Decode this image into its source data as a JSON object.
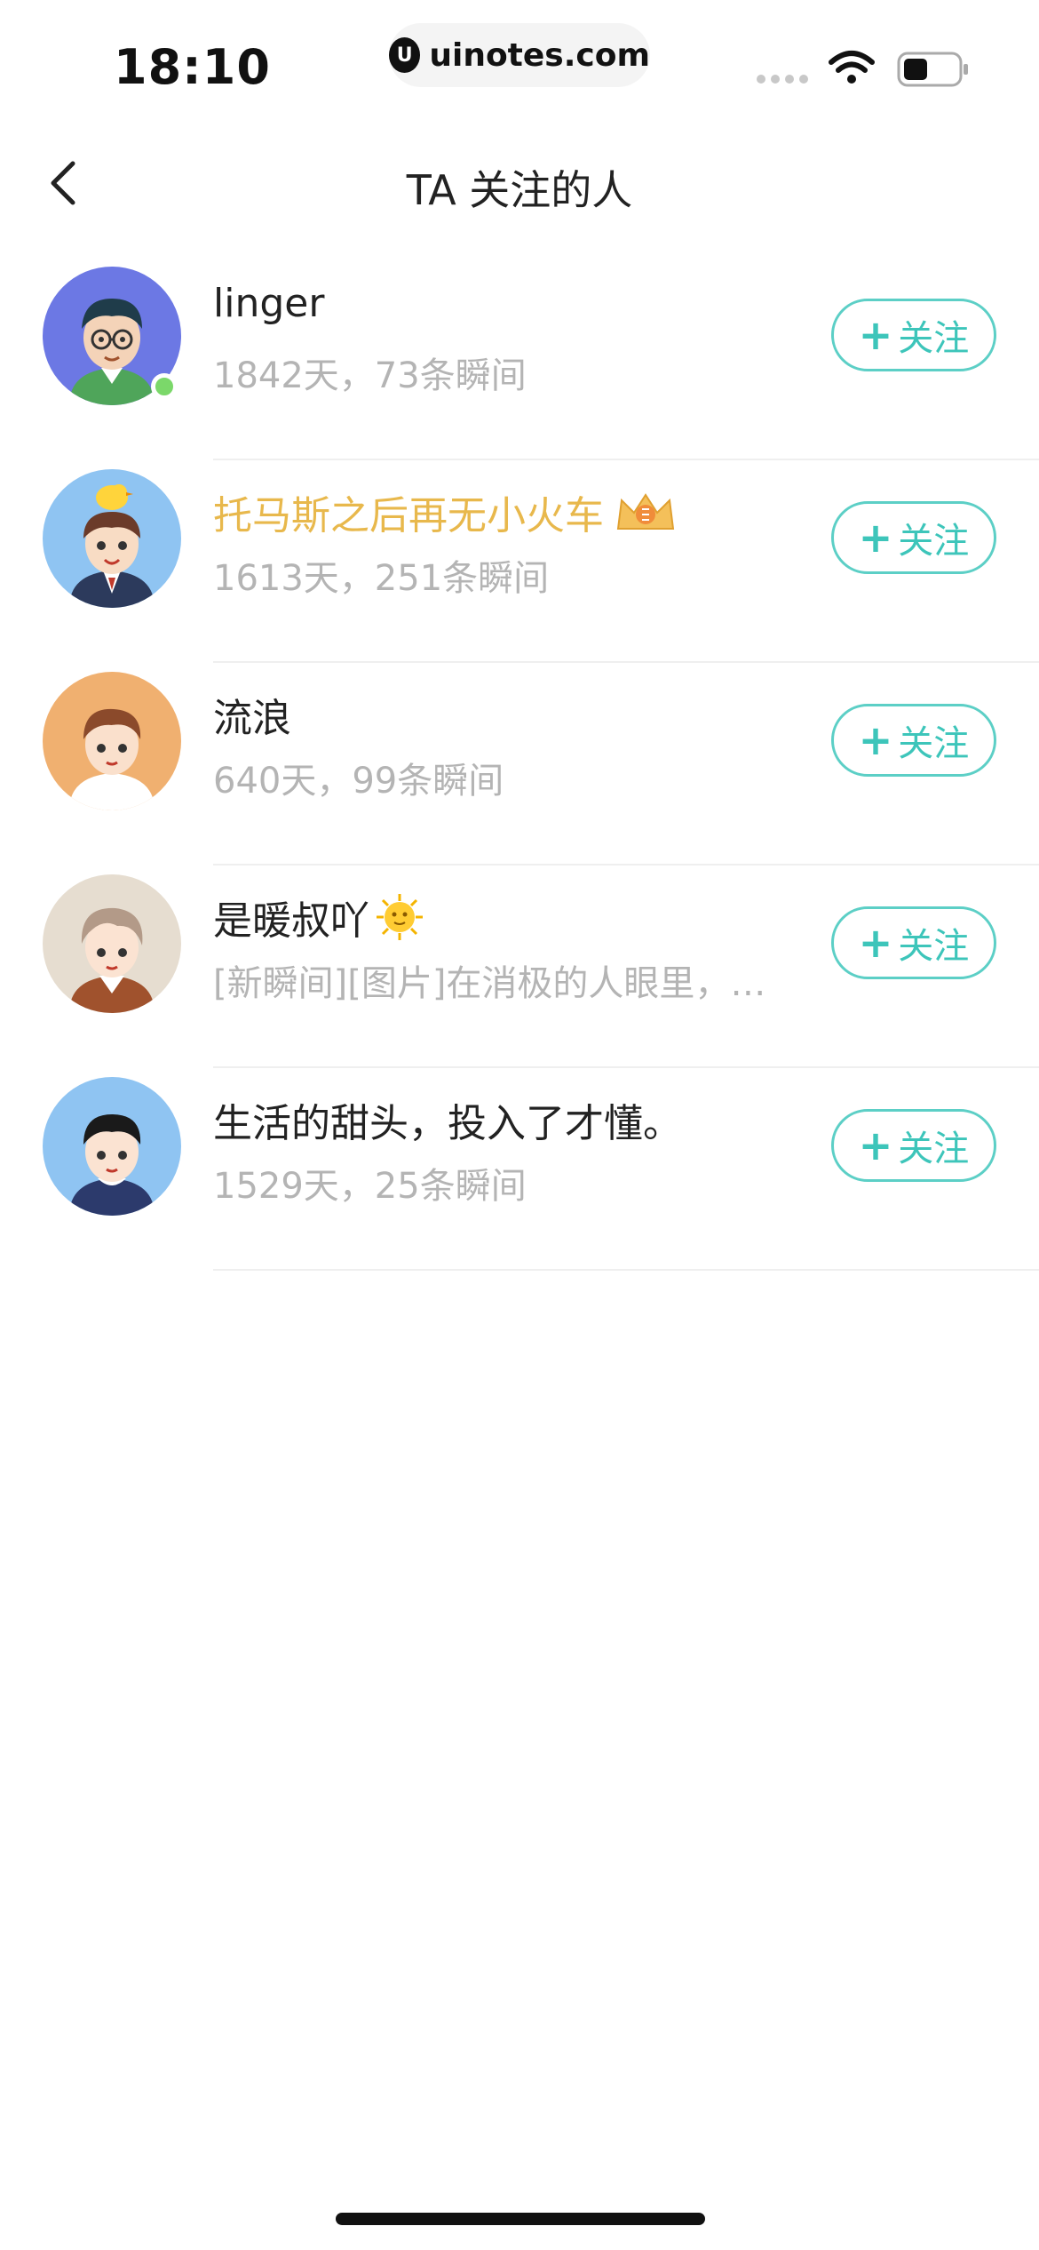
{
  "status_bar": {
    "time": "18:10",
    "url": "uinotes.com"
  },
  "nav": {
    "title": "TA 关注的人"
  },
  "follow_label": "关注",
  "users": [
    {
      "name": "linger",
      "sub": "1842天，73条瞬间",
      "online": true,
      "avatar_bg": "#6c78e4"
    },
    {
      "name": "托马斯之后再无小火车",
      "sub": "1613天，251条瞬间",
      "vip": true,
      "avatar_bg": "#8fc4f2"
    },
    {
      "name": "流浪",
      "sub": "640天，99条瞬间",
      "avatar_bg": "#f0b070"
    },
    {
      "name": "是暖叔吖",
      "sub": "[新瞬间][图片]在消极的人眼里，…",
      "avatar_bg": "#e6ddd0"
    },
    {
      "name": "生活的甜头，投入了才懂。",
      "sub": "1529天，25条瞬间",
      "avatar_bg": "#8fc4f2"
    }
  ]
}
